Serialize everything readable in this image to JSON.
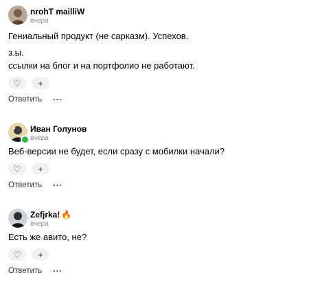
{
  "comments": [
    {
      "author": "nrohT mailliW",
      "date": "вчера",
      "paragraphs": [
        "Гениальный продукт (не сарказм). Успехов.",
        "з.ы.",
        "ссылки на блог и на портфолио не работают."
      ],
      "online": false,
      "badge": "",
      "avatar_icon": "avatar-portrait-icon"
    },
    {
      "author": "Иван Голунов",
      "date": "вчера",
      "paragraphs": [
        "Веб-версии не будет, если сразу с мобилки начали?"
      ],
      "online": true,
      "badge": "",
      "avatar_icon": "avatar-portrait-icon"
    },
    {
      "author": "Zefjrka!",
      "date": "вчера",
      "paragraphs": [
        "Есть же авито, не?"
      ],
      "online": false,
      "badge": "🔥",
      "avatar_icon": "avatar-portrait-icon"
    }
  ],
  "ui": {
    "reply_label": "Ответить",
    "more_label": "···",
    "like_icon": "heart-icon",
    "add_reaction_icon": "plus-icon",
    "like_glyph": "♡",
    "add_glyph": "+"
  },
  "colors": {
    "online": "#2dbd47",
    "muted_text": "#8a8a8a",
    "reaction_bg": "#f1f1f1"
  }
}
